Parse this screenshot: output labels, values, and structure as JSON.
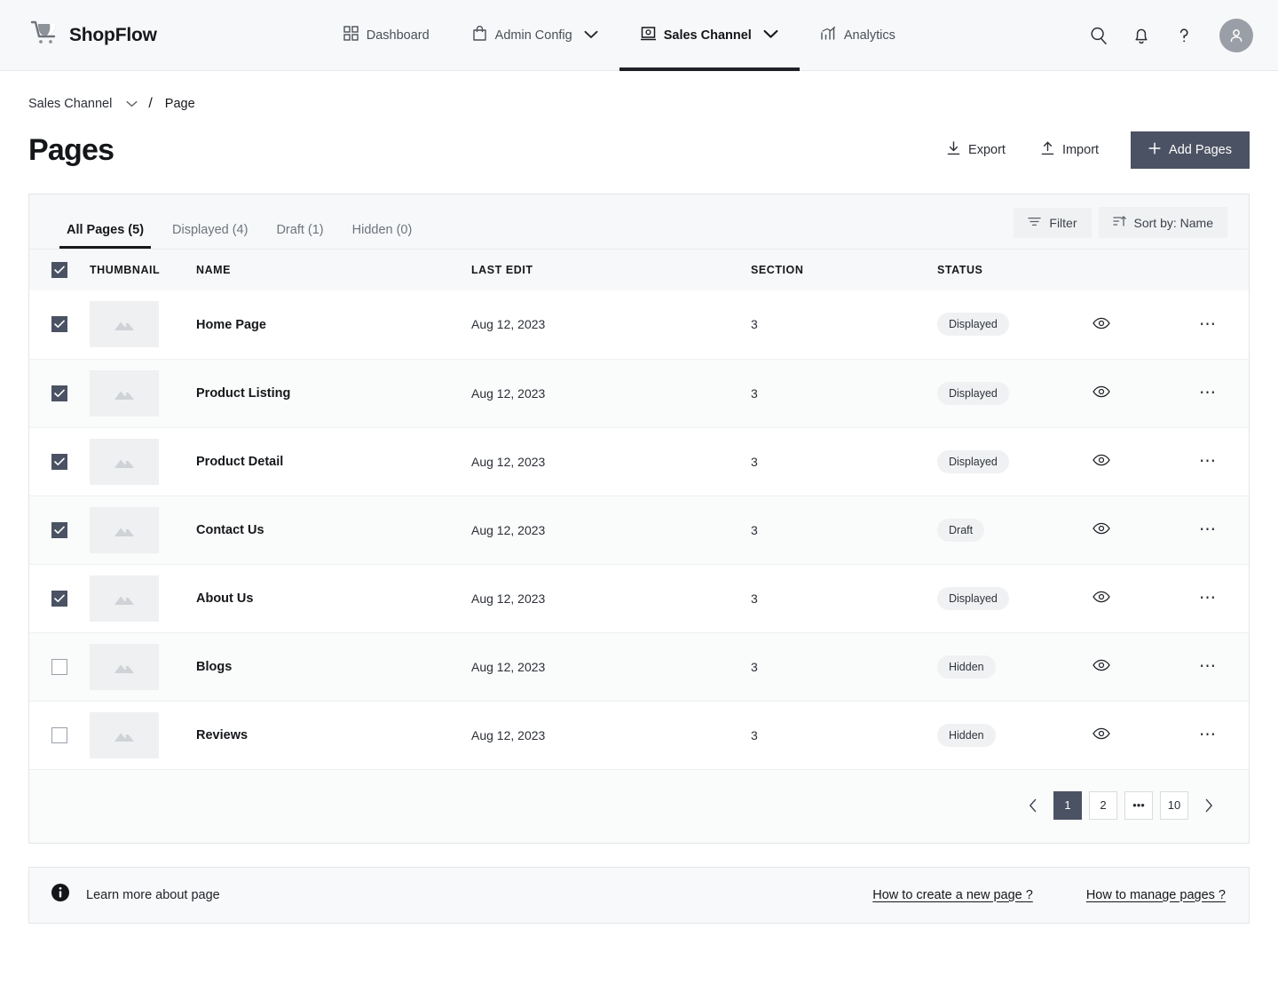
{
  "brand": {
    "name": "ShopFlow",
    "logo_icon": "shopping-cart-icon"
  },
  "nav": {
    "items": [
      {
        "label": "Dashboard",
        "icon": "grid-icon",
        "has_chevron": false,
        "active": false
      },
      {
        "label": "Admin Config",
        "icon": "bag-icon",
        "has_chevron": true,
        "active": false
      },
      {
        "label": "Sales Channel",
        "icon": "storefront-icon",
        "has_chevron": true,
        "active": true
      },
      {
        "label": "Analytics",
        "icon": "bar-chart-icon",
        "has_chevron": false,
        "active": false
      }
    ],
    "right_icons": [
      "search-icon",
      "bell-icon",
      "help-icon",
      "user-avatar-icon"
    ]
  },
  "breadcrumb": {
    "root": "Sales Channel",
    "separator": "/",
    "current": "Page"
  },
  "header": {
    "title": "Pages",
    "export_label": "Export",
    "import_label": "Import",
    "add_label": "Add Pages"
  },
  "toolbar": {
    "tabs": [
      {
        "label": "All Pages (5)",
        "active": true
      },
      {
        "label": "Displayed (4)",
        "active": false
      },
      {
        "label": "Draft (1)",
        "active": false
      },
      {
        "label": "Hidden (0)",
        "active": false
      }
    ],
    "filter_label": "Filter",
    "sort_label": "Sort by: Name"
  },
  "table": {
    "columns": [
      "THUMBNAIL",
      "NAME",
      "LAST EDIT",
      "SECTION",
      "STATUS"
    ],
    "header_checkbox_checked": true,
    "rows": [
      {
        "checked": true,
        "name": "Home Page",
        "last_edit": "Aug 12, 2023",
        "section": "3",
        "status": "Displayed"
      },
      {
        "checked": true,
        "name": "Product Listing",
        "last_edit": "Aug 12, 2023",
        "section": "3",
        "status": "Displayed"
      },
      {
        "checked": true,
        "name": "Product Detail",
        "last_edit": "Aug 12, 2023",
        "section": "3",
        "status": "Displayed"
      },
      {
        "checked": true,
        "name": "Contact Us",
        "last_edit": "Aug 12, 2023",
        "section": "3",
        "status": "Draft"
      },
      {
        "checked": true,
        "name": "About Us",
        "last_edit": "Aug 12, 2023",
        "section": "3",
        "status": "Displayed"
      },
      {
        "checked": false,
        "name": "Blogs",
        "last_edit": "Aug 12, 2023",
        "section": "3",
        "status": "Hidden"
      },
      {
        "checked": false,
        "name": "Reviews",
        "last_edit": "Aug 12, 2023",
        "section": "3",
        "status": "Hidden"
      }
    ]
  },
  "pagination": {
    "pages": [
      {
        "label": "1",
        "active": true
      },
      {
        "label": "2",
        "active": false
      },
      {
        "label": "•••",
        "active": false
      },
      {
        "label": "10",
        "active": false
      }
    ]
  },
  "help": {
    "icon": "info-icon",
    "text": "Learn more about page",
    "links": [
      "How to create a new page ?",
      "How to manage pages ?"
    ]
  },
  "colors": {
    "accent": "#4a5263",
    "nav_bg": "#f7f8f9",
    "text": "#15171b",
    "muted": "#6e747d",
    "border": "#e4e6ea"
  }
}
